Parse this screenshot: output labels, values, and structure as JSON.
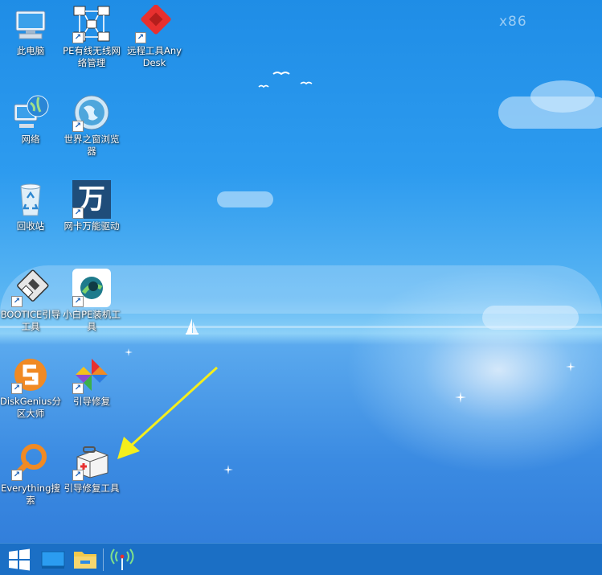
{
  "watermark": "x86",
  "icons": [
    {
      "id": "this-pc",
      "label": "此电脑"
    },
    {
      "id": "pe-network",
      "label": "PE有线无线网络管理"
    },
    {
      "id": "anydesk",
      "label": "远程工具AnyDesk"
    },
    {
      "id": "network",
      "label": "网络"
    },
    {
      "id": "browser",
      "label": "世界之窗浏览器"
    },
    {
      "id": "recycle-bin",
      "label": "回收站"
    },
    {
      "id": "nic-driver",
      "label": "网卡万能驱动"
    },
    {
      "id": "bootice",
      "label": "BOOTICE引导工具"
    },
    {
      "id": "xiaobai-pe",
      "label": "小白PE装机工具"
    },
    {
      "id": "diskgenius",
      "label": "DiskGenius分区大师"
    },
    {
      "id": "boot-repair",
      "label": "引导修复"
    },
    {
      "id": "everything",
      "label": "Everything搜索"
    },
    {
      "id": "boot-repair-tool",
      "label": "引导修复工具"
    }
  ],
  "nic_glyph": "万",
  "colors": {
    "taskbar": "#1b6fc5",
    "arrow": "#f4ee1c",
    "anydesk": "#e8302f"
  },
  "taskbar": {
    "items": [
      "start-icon",
      "desktop-icon",
      "file-explorer-icon",
      "network-tray-icon"
    ]
  }
}
